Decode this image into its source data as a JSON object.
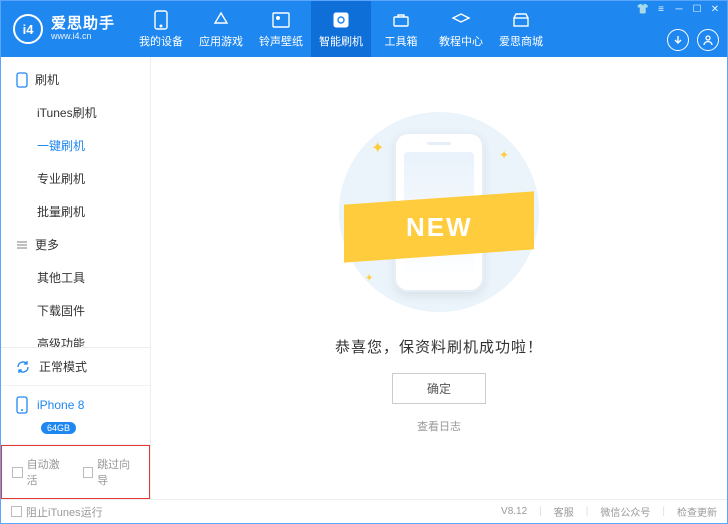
{
  "header": {
    "logo_initials": "i4",
    "logo_title": "爱思助手",
    "logo_sub": "www.i4.cn",
    "tabs": [
      {
        "label": "我的设备"
      },
      {
        "label": "应用游戏"
      },
      {
        "label": "铃声壁纸"
      },
      {
        "label": "智能刷机"
      },
      {
        "label": "工具箱"
      },
      {
        "label": "教程中心"
      },
      {
        "label": "爱思商城"
      }
    ],
    "active_tab_index": 3
  },
  "sidebar": {
    "group1_title": "刷机",
    "group1_items": [
      "iTunes刷机",
      "一键刷机",
      "专业刷机",
      "批量刷机"
    ],
    "group1_active_index": 1,
    "group2_title": "更多",
    "group2_items": [
      "其他工具",
      "下载固件",
      "高级功能"
    ],
    "mode_label": "正常模式",
    "device_name": "iPhone 8",
    "device_storage": "64GB",
    "opt_auto_activate": "自动激活",
    "opt_skip_wizard": "跳过向导"
  },
  "main": {
    "ribbon_text": "NEW",
    "success_message": "恭喜您，保资料刷机成功啦！",
    "ok_button": "确定",
    "view_log": "查看日志"
  },
  "footer": {
    "block_itunes": "阻止iTunes运行",
    "version": "V8.12",
    "support": "客服",
    "wechat": "微信公众号",
    "check_update": "检查更新"
  }
}
